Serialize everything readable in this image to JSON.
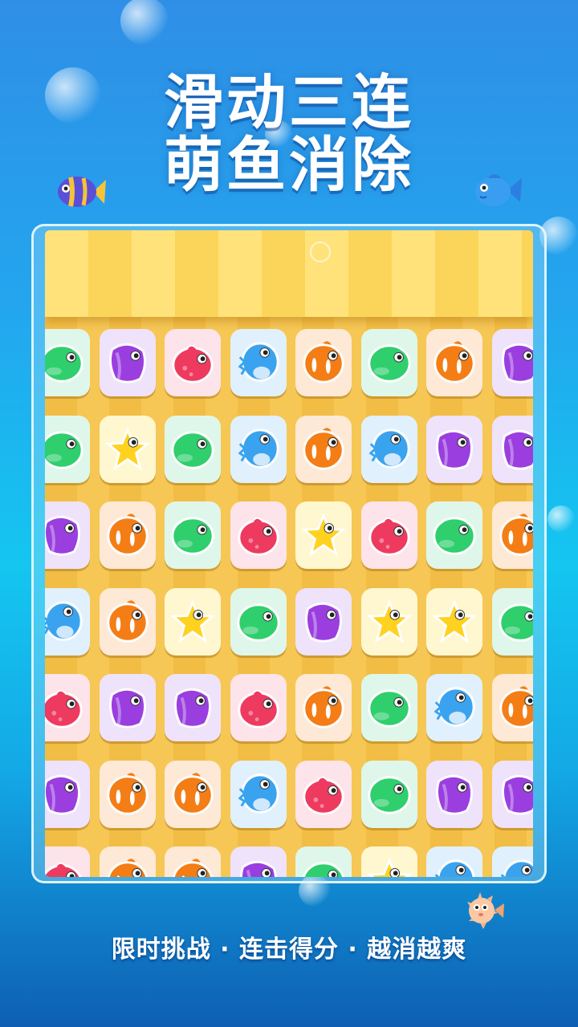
{
  "title_line1": "滑动三连",
  "title_line2": "萌鱼消除",
  "tagline": "限时挑战 · 连击得分 · 越消越爽",
  "fish_colors": {
    "green": "#2fcf6d",
    "purple": "#9a3ee0",
    "red": "#ee3a5f",
    "blue": "#3aa3ef",
    "orange": "#f47d15",
    "yellow": "#ffd21f"
  },
  "tile_backgrounds": {
    "green": "#dff7ea",
    "purple": "#efe2fb",
    "red": "#fde4ea",
    "blue": "#e0f1fd",
    "orange": "#fde9d6",
    "yellow": "#fff7cf"
  },
  "grid": [
    [
      "green",
      "purple",
      "red",
      "blue",
      "orange",
      "green",
      "orange",
      "purple"
    ],
    [
      "green",
      "yellow",
      "green",
      "blue",
      "orange",
      "blue",
      "purple",
      "purple"
    ],
    [
      "purple",
      "orange",
      "green",
      "red",
      "yellow",
      "red",
      "green",
      "orange"
    ],
    [
      "blue",
      "orange",
      "yellow",
      "green",
      "purple",
      "yellow",
      "yellow",
      "green"
    ],
    [
      "red",
      "purple",
      "purple",
      "red",
      "orange",
      "green",
      "blue",
      "orange"
    ],
    [
      "purple",
      "orange",
      "orange",
      "blue",
      "red",
      "green",
      "purple",
      "purple"
    ],
    [
      "red",
      "orange",
      "orange",
      "purple",
      "green",
      "yellow",
      "blue",
      "blue"
    ]
  ]
}
